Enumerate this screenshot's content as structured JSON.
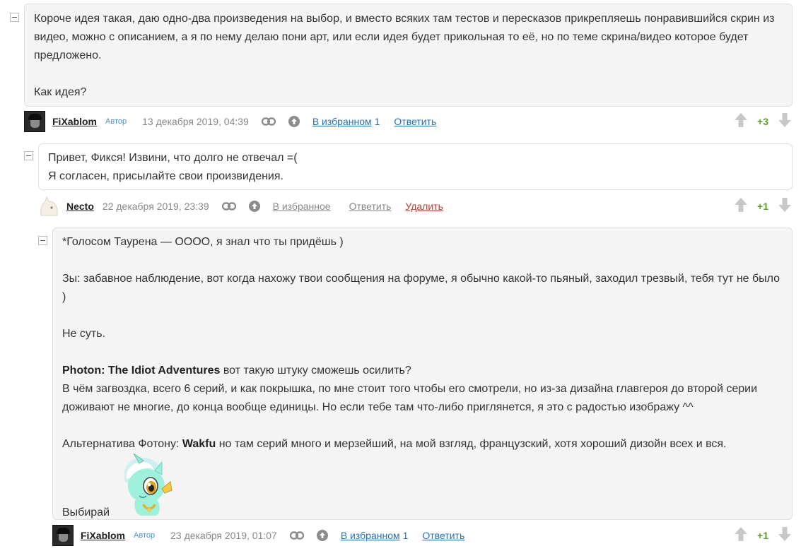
{
  "comments": [
    {
      "paragraphs": [
        "Короче идея такая, даю одно-два произведения на выбор, и вместо всяких там тестов и пересказов прикрепляешь понравившийся скрин из видео, можно с описанием, а я по нему делаю пони арт, или если идея будет прикольная то её, но по теме скрина/видео которое будет предложено.",
        "Как идея?"
      ],
      "author": "FiXablom",
      "role": "Автор",
      "date": "13 декабря 2019, 04:39",
      "favorite_label": "В избранном",
      "favorite_count": "1",
      "reply_label": "Ответить",
      "score": "+3"
    },
    {
      "lines": [
        "Привет, Фикся! Извини, что долго не отвечал =(",
        "Я согласен, присылайте свои произвидения."
      ],
      "author": "Necto",
      "date": "22 декабря 2019, 23:39",
      "favorite_label": "В избранное",
      "reply_label": "Ответить",
      "delete_label": "Удалить",
      "score": "+1"
    },
    {
      "p1": "*Голосом Таурена — ОООО, я знал что ты придёшь )",
      "p2": "Зы: забавное наблюдение, вот когда нахожу твои сообщения на форуме, я обычно какой-то пьяный, заходил трезвый, тебя тут не было )",
      "p3": "Не суть.",
      "p4_bold": "Photon: The Idiot Adventures",
      "p4_rest": " вот такую штуку сможешь осилить?",
      "p5": "В чём загвоздка, всего 6 серий, и как покрышка, по мне стоит того чтобы его смотрели, но из-за дизайна главгероя до второй серии доживают не многие, до конца вообще единицы. Но если тебе там что-либо приглянется, я это с радостью изображу ^^",
      "p6_pre": "Альтернатива Фотону: ",
      "p6_bold": "Wakfu",
      "p6_rest": " но там серий много и мерзейший, на мой взгляд, французский, хотя хороший дизойн всех и вся.",
      "p7": "Выбирай",
      "author": "FiXablom",
      "role": "Автор",
      "date": "23 декабря 2019, 01:07",
      "favorite_label": "В избранном",
      "favorite_count": "1",
      "reply_label": "Ответить",
      "score": "+1"
    }
  ],
  "icons": {
    "link": "link-icon",
    "up": "scroll-up-icon",
    "vote_up": "thumb-up-arrow-icon",
    "vote_down": "thumb-down-arrow-icon",
    "collapse": "collapse-minus-icon"
  },
  "colors": {
    "accent": "#2a6fb0",
    "score": "#5aa02c",
    "delete": "#c0392b",
    "bubble_bg": "#f4f4f4"
  }
}
